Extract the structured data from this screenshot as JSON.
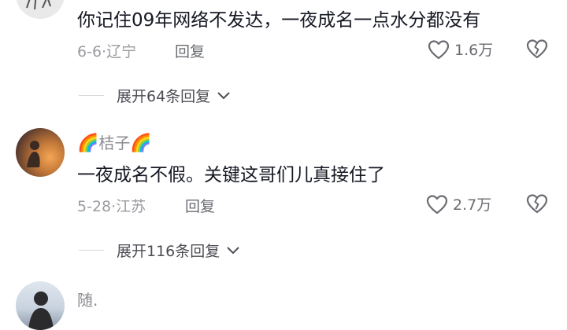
{
  "comments": [
    {
      "text": "你记住09年网络不发达，一夜成名一点水分都没有",
      "date": "6-6",
      "location": "辽宁",
      "reply_label": "回复",
      "likes": "1.6万",
      "expand_label": "展开64条回复"
    },
    {
      "username": "桔子",
      "username_decoration": "🌈",
      "text": "一夜成名不假。关键这哥们儿真接住了",
      "date": "5-28",
      "location": "江苏",
      "reply_label": "回复",
      "likes": "2.7万",
      "expand_label": "展开116条回复"
    },
    {
      "username": "随."
    }
  ],
  "colors": {
    "primary_text": "#161823",
    "secondary_text": "#9a9ba1",
    "icon": "#6b6c72"
  }
}
